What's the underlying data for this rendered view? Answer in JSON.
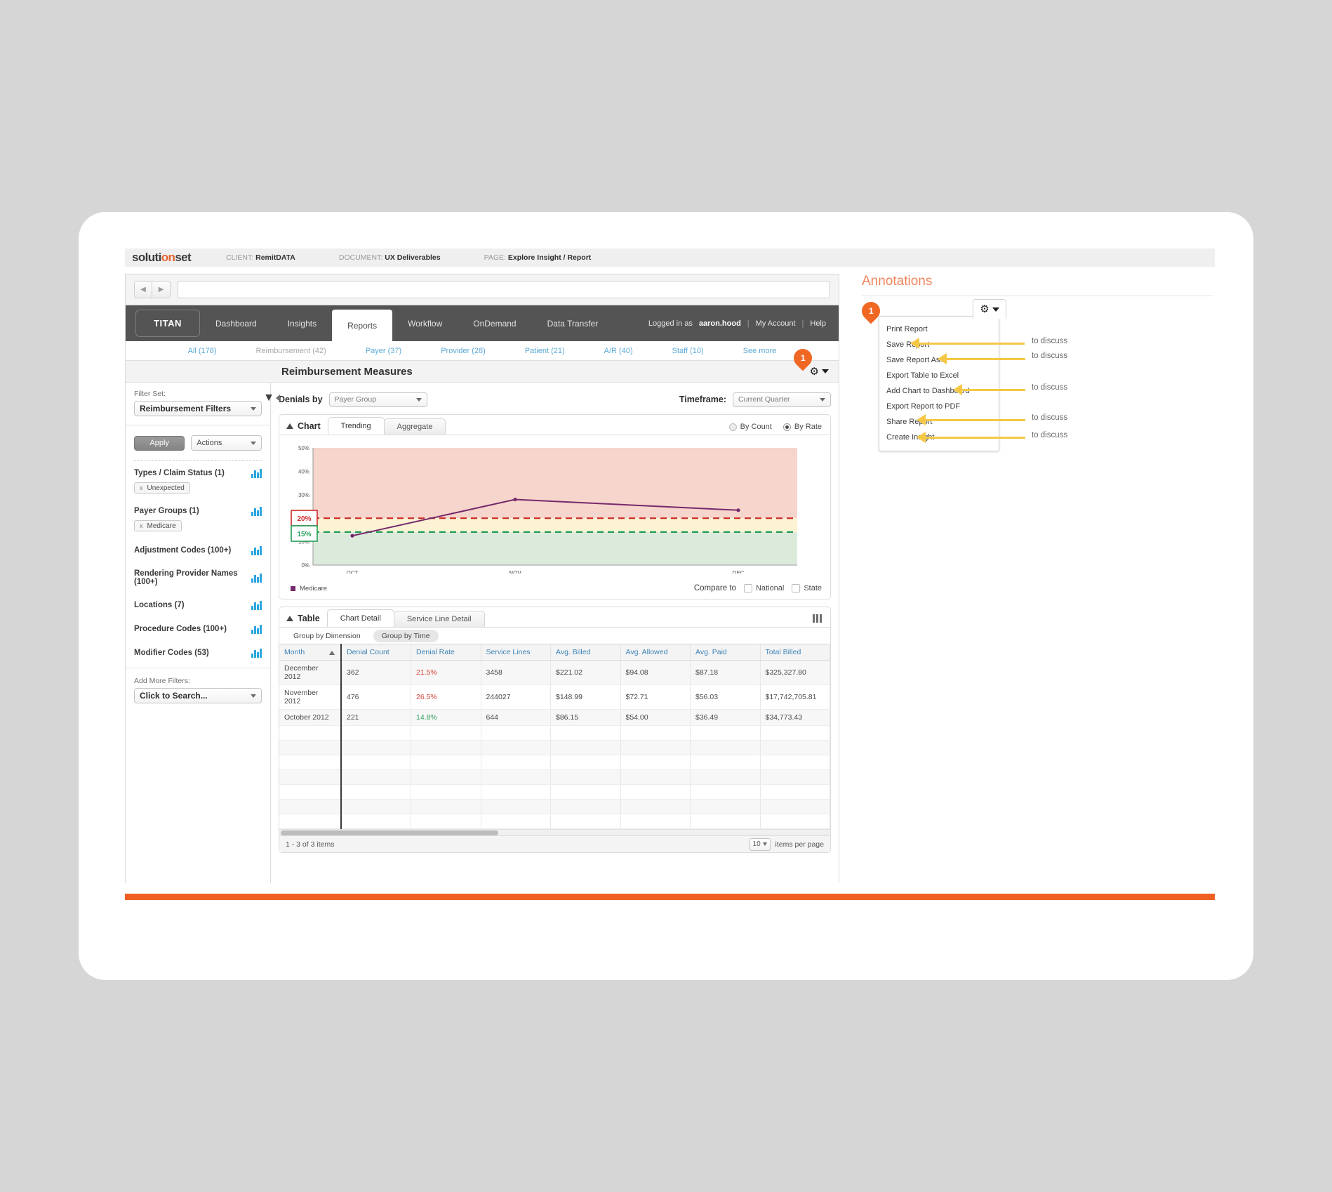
{
  "doc_bar": {
    "logo_prefix": "soluti",
    "logo_accent": "on",
    "logo_suffix": "set",
    "client_label": "CLIENT:",
    "client_value": "RemitDATA",
    "document_label": "DOCUMENT:",
    "document_value": "UX Deliverables",
    "page_label": "PAGE:",
    "page_value": "Explore Insight / Report"
  },
  "topnav": {
    "brand": "TITAN",
    "items": [
      {
        "label": "Dashboard",
        "active": false
      },
      {
        "label": "Insights",
        "active": false
      },
      {
        "label": "Reports",
        "active": true
      },
      {
        "label": "Workflow",
        "active": false
      },
      {
        "label": "OnDemand",
        "active": false
      },
      {
        "label": "Data Transfer",
        "active": false
      }
    ],
    "logged_in_prefix": "Logged in as",
    "username": "aaron.hood",
    "my_account": "My Account",
    "help": "Help",
    "separator": "|"
  },
  "subnav": {
    "items": [
      {
        "label": "All (178)",
        "muted": false
      },
      {
        "label": "Reimbursement (42)",
        "muted": true
      },
      {
        "label": "Payer (37)",
        "muted": false
      },
      {
        "label": "Provider (28)",
        "muted": false
      },
      {
        "label": "Patient (21)",
        "muted": false
      },
      {
        "label": "A/R (40)",
        "muted": false
      },
      {
        "label": "Staff (10)",
        "muted": false
      },
      {
        "label": "See more",
        "muted": false
      }
    ]
  },
  "report": {
    "title": "Reimbursement Measures",
    "pin_label": "1"
  },
  "sidebar": {
    "filter_set_label": "Filter Set:",
    "filter_set_value": "Reimbursement Filters",
    "apply_label": "Apply",
    "actions_label": "Actions",
    "groups": [
      {
        "name": "Types / Claim Status (1)",
        "chip": "Unexpected"
      },
      {
        "name": "Payer Groups (1)",
        "chip": "Medicare"
      },
      {
        "name": "Adjustment Codes (100+)",
        "chip": null
      },
      {
        "name": "Rendering Provider Names (100+)",
        "chip": null
      },
      {
        "name": "Locations (7)",
        "chip": null
      },
      {
        "name": "Procedure Codes (100+)",
        "chip": null
      },
      {
        "name": "Modifier Codes (53)",
        "chip": null
      }
    ],
    "chip_remove": "x",
    "add_more_label": "Add More Filters:",
    "add_more_value": "Click to Search..."
  },
  "controls": {
    "denials_by_label": "Denials by",
    "denials_by_value": "Payer Group",
    "timeframe_label": "Timeframe:",
    "timeframe_value": "Current Quarter"
  },
  "chart_panel": {
    "title": "Chart",
    "tabs": [
      {
        "label": "Trending",
        "selected": true
      },
      {
        "label": "Aggregate",
        "selected": false
      }
    ],
    "by_count_label": "By Count",
    "by_rate_label": "By Rate",
    "selected_measure": "By Rate",
    "legend_label": "Medicare",
    "compare_label": "Compare to",
    "compare_options": [
      {
        "label": "National",
        "checked": false
      },
      {
        "label": "State",
        "checked": false
      }
    ]
  },
  "chart_data": {
    "type": "line",
    "title": "Reimbursement Measures - Denials by Payer Group",
    "xlabel": "",
    "ylabel": "",
    "categories": [
      "OCT",
      "NOV",
      "DEC"
    ],
    "ytick_labels": [
      "0%",
      "10%",
      "20%",
      "30%",
      "40%",
      "50%"
    ],
    "ylim": [
      0,
      50
    ],
    "grid": false,
    "legend_position": "bottom-left",
    "series": [
      {
        "name": "Medicare",
        "color": "#76296b",
        "values": [
          12.5,
          28.0,
          23.4
        ]
      }
    ],
    "thresholds": [
      {
        "label": "20%",
        "value": 20,
        "color": "#cc2a27",
        "style": "dashed"
      },
      {
        "label": "15%",
        "value": 14.1,
        "color": "#1f9d55",
        "style": "dashed"
      }
    ],
    "bands": [
      {
        "from": 20,
        "to": 50,
        "color": "#f6d5cc"
      },
      {
        "from": 14.1,
        "to": 20,
        "color": "#fbf3d4"
      },
      {
        "from": 0,
        "to": 14.1,
        "color": "#dceadc"
      }
    ]
  },
  "table_panel": {
    "title": "Table",
    "tabs": [
      {
        "label": "Chart Detail",
        "selected": true
      },
      {
        "label": "Service Line Detail",
        "selected": false
      }
    ],
    "group_by_dimension": "Group by Dimension",
    "group_by_time": "Group by Time",
    "columns": [
      "Month",
      "Denial Count",
      "Denial Rate",
      "Service Lines",
      "Avg. Billed",
      "Avg. Allowed",
      "Avg. Paid",
      "Total Billed"
    ],
    "sorted_column": "Month",
    "rows": [
      {
        "cells": [
          "December 2012",
          "362",
          "21.5%",
          "3458",
          "$221.02",
          "$94.08",
          "$87.18",
          "$325,327.80"
        ],
        "rate_state": "red"
      },
      {
        "cells": [
          "November 2012",
          "476",
          "26.5%",
          "244027",
          "$148.99",
          "$72.71",
          "$56.03",
          "$17,742,705.81"
        ],
        "rate_state": "red"
      },
      {
        "cells": [
          "October 2012",
          "221",
          "14.8%",
          "644",
          "$86.15",
          "$54.00",
          "$36.49",
          "$34,773.43"
        ],
        "rate_state": "green"
      }
    ],
    "empty_row_count": 7,
    "footer_count": "1 - 3 of 3 items",
    "items_per_page_value": "10",
    "items_per_page_label": "items per page"
  },
  "annotations": {
    "heading": "Annotations",
    "menu_items": [
      {
        "label": "Print Report",
        "callout": null
      },
      {
        "label": "Save Report",
        "callout": "to discuss"
      },
      {
        "label": "Save Report As...",
        "callout": "to discuss"
      },
      {
        "label": "Export Table to Excel",
        "callout": null
      },
      {
        "label": "Add Chart to Dashboard",
        "callout": "to discuss"
      },
      {
        "label": "Export Report to PDF",
        "callout": null
      },
      {
        "label": "Share Report",
        "callout": "to discuss"
      },
      {
        "label": "Create Insight",
        "callout": null
      }
    ],
    "create_insight_callout": "to discuss",
    "pin_label": "1"
  },
  "colors": {
    "accent_orange": "#ef5f23",
    "link_blue": "#5aa9d6",
    "series_purple": "#76296b",
    "threshold_red": "#cc2a27",
    "threshold_green": "#1f9d55",
    "callout_yellow": "#f5c744"
  }
}
